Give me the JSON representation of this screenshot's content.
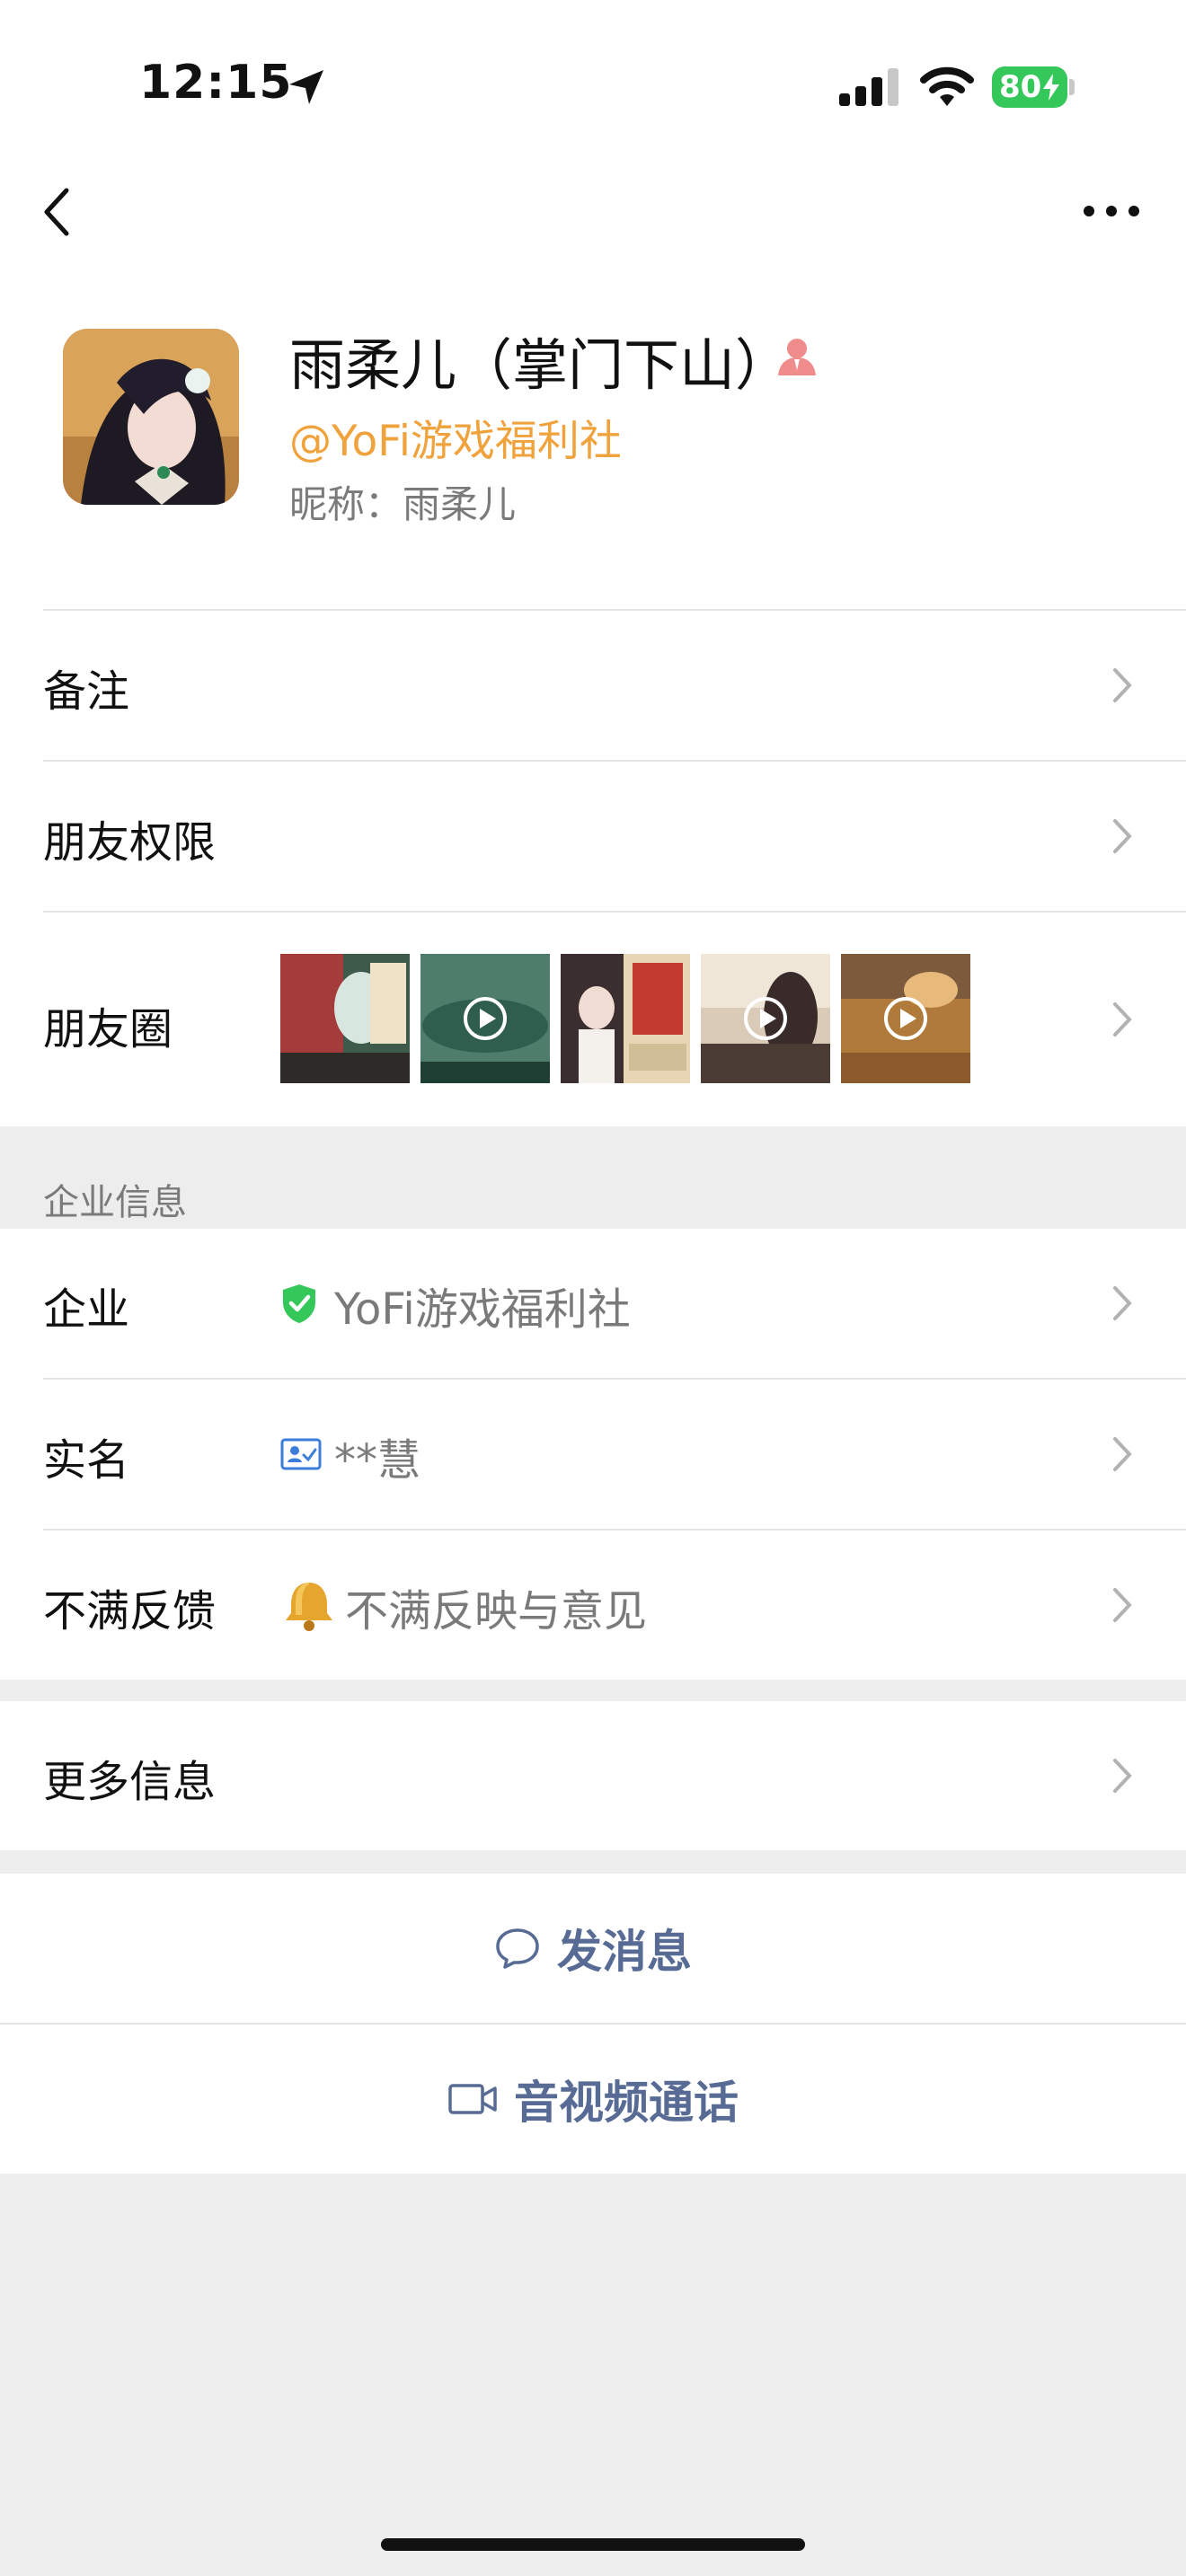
{
  "status_bar": {
    "time": "12:15",
    "battery": "80"
  },
  "profile": {
    "name": "雨柔儿（掌门下山）",
    "corp": "@YoFi游戏福利社",
    "nickname": "昵称：雨柔儿"
  },
  "rows": {
    "remark": "备注",
    "friend_permissions": "朋友权限",
    "moments": "朋友圈"
  },
  "enterprise_section": {
    "title": "企业信息",
    "enterprise_label": "企业",
    "enterprise_value": "YoFi游戏福利社",
    "realname_label": "实名",
    "realname_value": "**慧",
    "feedback_label": "不满反馈",
    "feedback_value": "不满反映与意见"
  },
  "more_info": "更多信息",
  "actions": {
    "message": "发消息",
    "call": "音视频通话"
  },
  "colors": {
    "link": "#576b95",
    "corp": "#f0a23c",
    "verified": "#34c759"
  }
}
